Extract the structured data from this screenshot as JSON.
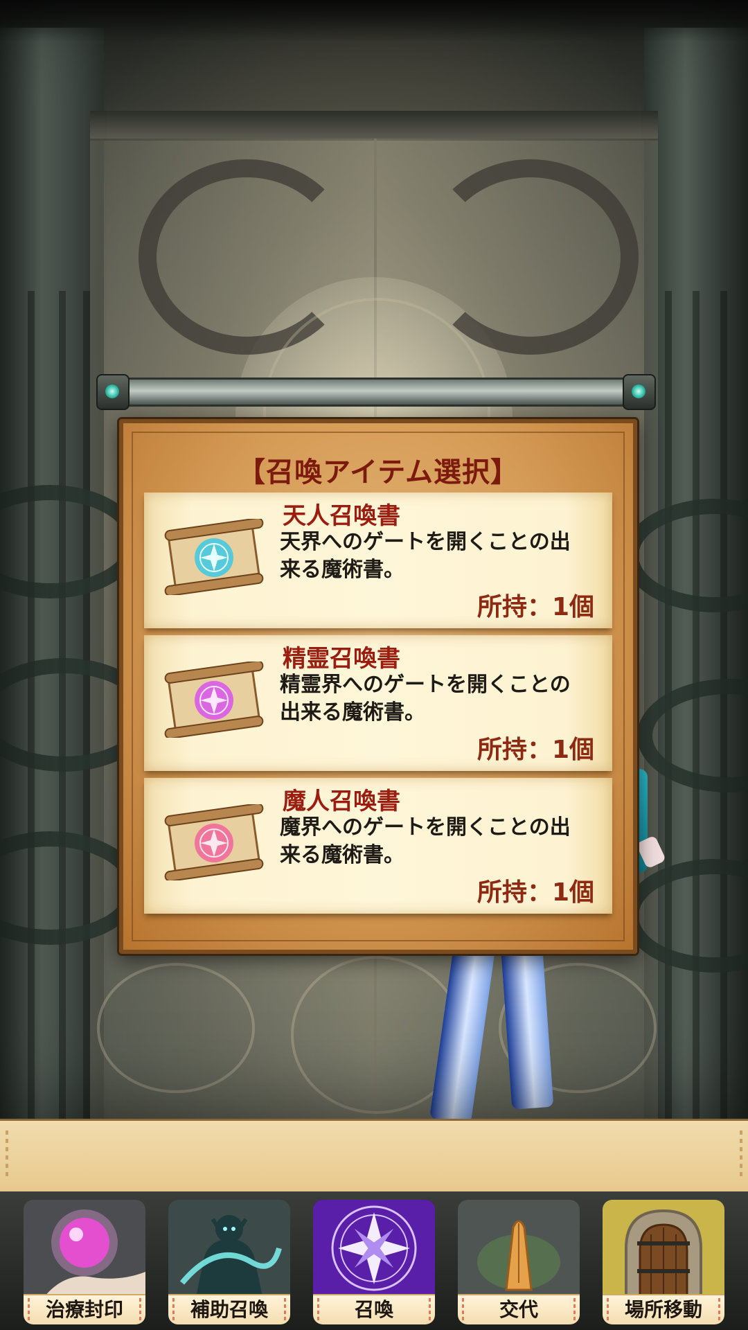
{
  "dialog": {
    "title": "【召喚アイテム選択】",
    "items": [
      {
        "name": "天人召喚書",
        "description": "天界へのゲートを開くことの出来る魔術書。",
        "count": "所持：1個",
        "icon": "scroll-blue-sigil-icon",
        "sigil_color": "#47c9e0"
      },
      {
        "name": "精霊召喚書",
        "description": "精霊界へのゲートを開くことの出来る魔術書。",
        "count": "所持：1個",
        "icon": "scroll-purple-sigil-icon",
        "sigil_color": "#d85be8"
      },
      {
        "name": "魔人召喚書",
        "description": "魔界へのゲートを開くことの出来る魔術書。",
        "count": "所持：1個",
        "icon": "scroll-pink-sigil-icon",
        "sigil_color": "#ef6a9a"
      }
    ]
  },
  "nav": {
    "items": [
      {
        "label": "治療封印",
        "icon": "healing-orb-icon"
      },
      {
        "label": "補助召喚",
        "icon": "spirit-summon-icon"
      },
      {
        "label": "召喚",
        "icon": "magic-circle-icon",
        "active": true
      },
      {
        "label": "交代",
        "icon": "praying-hands-icon"
      },
      {
        "label": "場所移動",
        "icon": "door-icon"
      }
    ]
  },
  "colors": {
    "title_red": "#7d1a0e",
    "item_name_red": "#9b1d10",
    "count_brown": "#8e2a12",
    "panel_orange": "#d49a55",
    "nav_active_purple": "#5a1fa8"
  }
}
